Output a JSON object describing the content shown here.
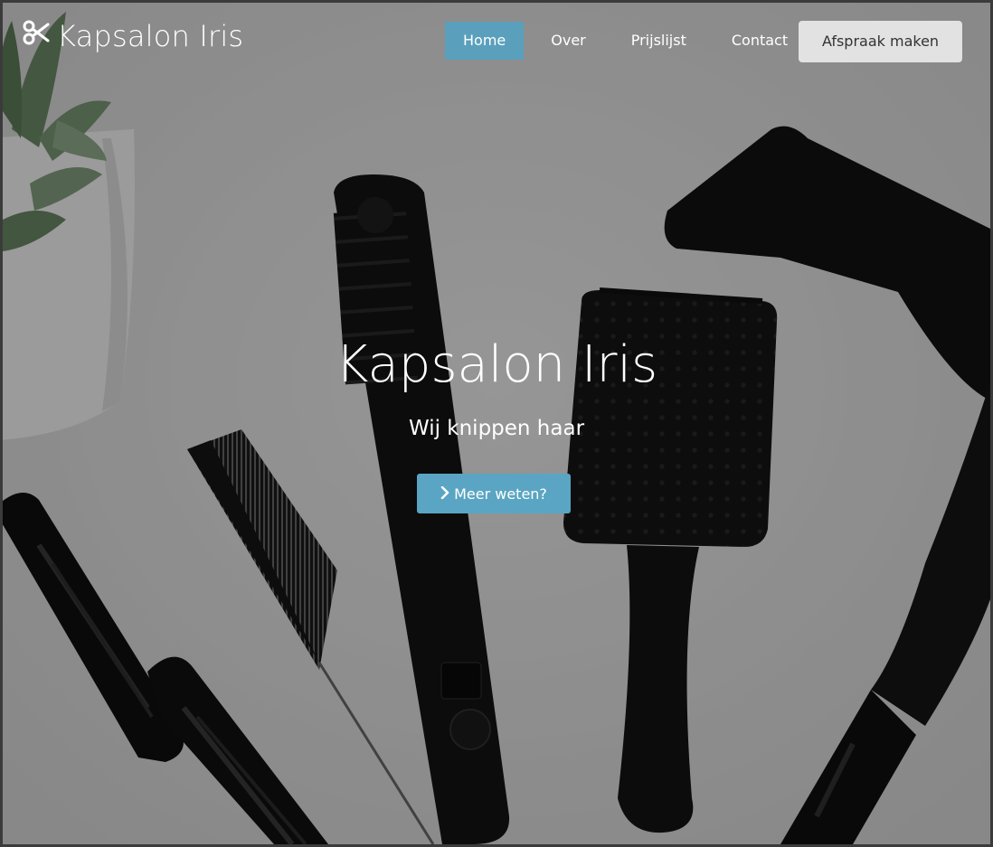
{
  "brand": {
    "name": "Kapsalon Iris",
    "icon": "scissors-icon"
  },
  "nav": {
    "items": [
      {
        "label": "Home",
        "active": true
      },
      {
        "label": "Over",
        "active": false
      },
      {
        "label": "Prijslijst",
        "active": false
      },
      {
        "label": "Contact",
        "active": false
      }
    ],
    "cta_label": "Afspraak maken"
  },
  "hero": {
    "title": "Kapsalon Iris",
    "subtitle": "Wij knippen haar",
    "button_label": "Meer weten?",
    "button_icon": "chevron-right-icon"
  },
  "colors": {
    "accent": "#5aa5c3",
    "active_nav": "#5aa0bd",
    "cta_bg": "#e2e2e2",
    "overlay": "rgba(0,0,0,0.38)"
  }
}
